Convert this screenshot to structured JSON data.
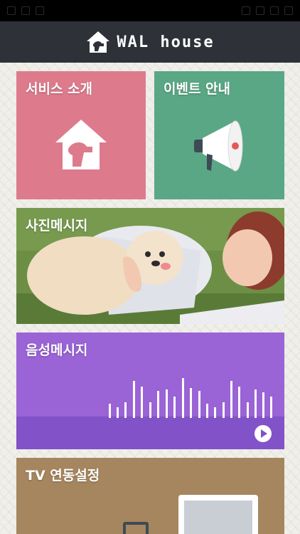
{
  "header": {
    "logo_text": "WAL house"
  },
  "tiles": {
    "service": {
      "label": "서비스 소개",
      "color": "#dd7b8d"
    },
    "event": {
      "label": "이벤트 안내",
      "color": "#5aa785"
    },
    "photo": {
      "label": "사진메시지"
    },
    "voice": {
      "label": "음성메시지",
      "color": "#9a63d6"
    },
    "tv": {
      "label": "TV 연동설정",
      "color": "#a6865f"
    }
  },
  "icons": {
    "logo": "house-dog-icon",
    "service": "house-dog-icon",
    "event": "megaphone-icon",
    "voice_play": "play-icon",
    "tv": "tv-icon"
  }
}
